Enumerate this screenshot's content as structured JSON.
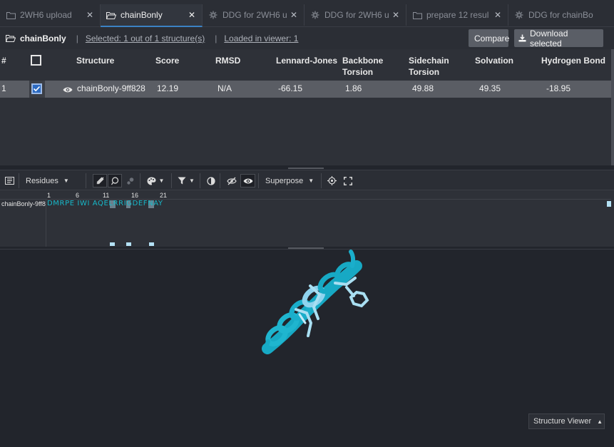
{
  "tabs": [
    {
      "label": "2WH6 upload",
      "icon": "folder-icon",
      "active": false
    },
    {
      "label": "chainBonly",
      "icon": "folder-open-icon",
      "active": true
    },
    {
      "label": "DDG for 2WH6 u",
      "icon": "gear-icon",
      "active": false
    },
    {
      "label": "DDG for 2WH6 u",
      "icon": "gear-icon",
      "active": false
    },
    {
      "label": "prepare 12 resul",
      "icon": "folder-icon",
      "active": false
    },
    {
      "label": "DDG for chainBo",
      "icon": "gear-icon",
      "active": false
    }
  ],
  "header": {
    "title": "chainBonly",
    "selected": "Selected: 1 out of 1 structure(s)",
    "loaded": "Loaded in viewer: 1",
    "compare_label": "Compare",
    "download_label": "Download selected"
  },
  "table": {
    "columns": [
      "#",
      "Structure",
      "Score",
      "RMSD",
      "Lennard-Jones",
      "Backbone",
      "Torsion",
      "Sidechain",
      "Torsion",
      "Solvation",
      "Hydrogen Bond"
    ],
    "row": {
      "num": "1",
      "structure": "chainBonly-9ff828",
      "score": "12.19",
      "rmsd": "N/A",
      "lj": "-66.15",
      "backbone": "1.86",
      "sidechain": "49.88",
      "solvation": "49.35",
      "hbond": "-18.95",
      "checked": true
    }
  },
  "toolbar": {
    "residues_label": "Residues",
    "superpose_label": "Superpose"
  },
  "sequence": {
    "label": "chainBonly-9ff8",
    "numbers": [
      "1",
      "6",
      "11",
      "16",
      "21"
    ],
    "residues": "DMRPE IWI AQELRRIGDEFNAY"
  },
  "viewer": {
    "mode_label": "Structure Viewer"
  },
  "colors": {
    "accent": "#3b82c4",
    "ribbon_dark": "#17a9c4",
    "ribbon_light": "#8fd3ee",
    "sequence_text": "#17b8c9"
  }
}
